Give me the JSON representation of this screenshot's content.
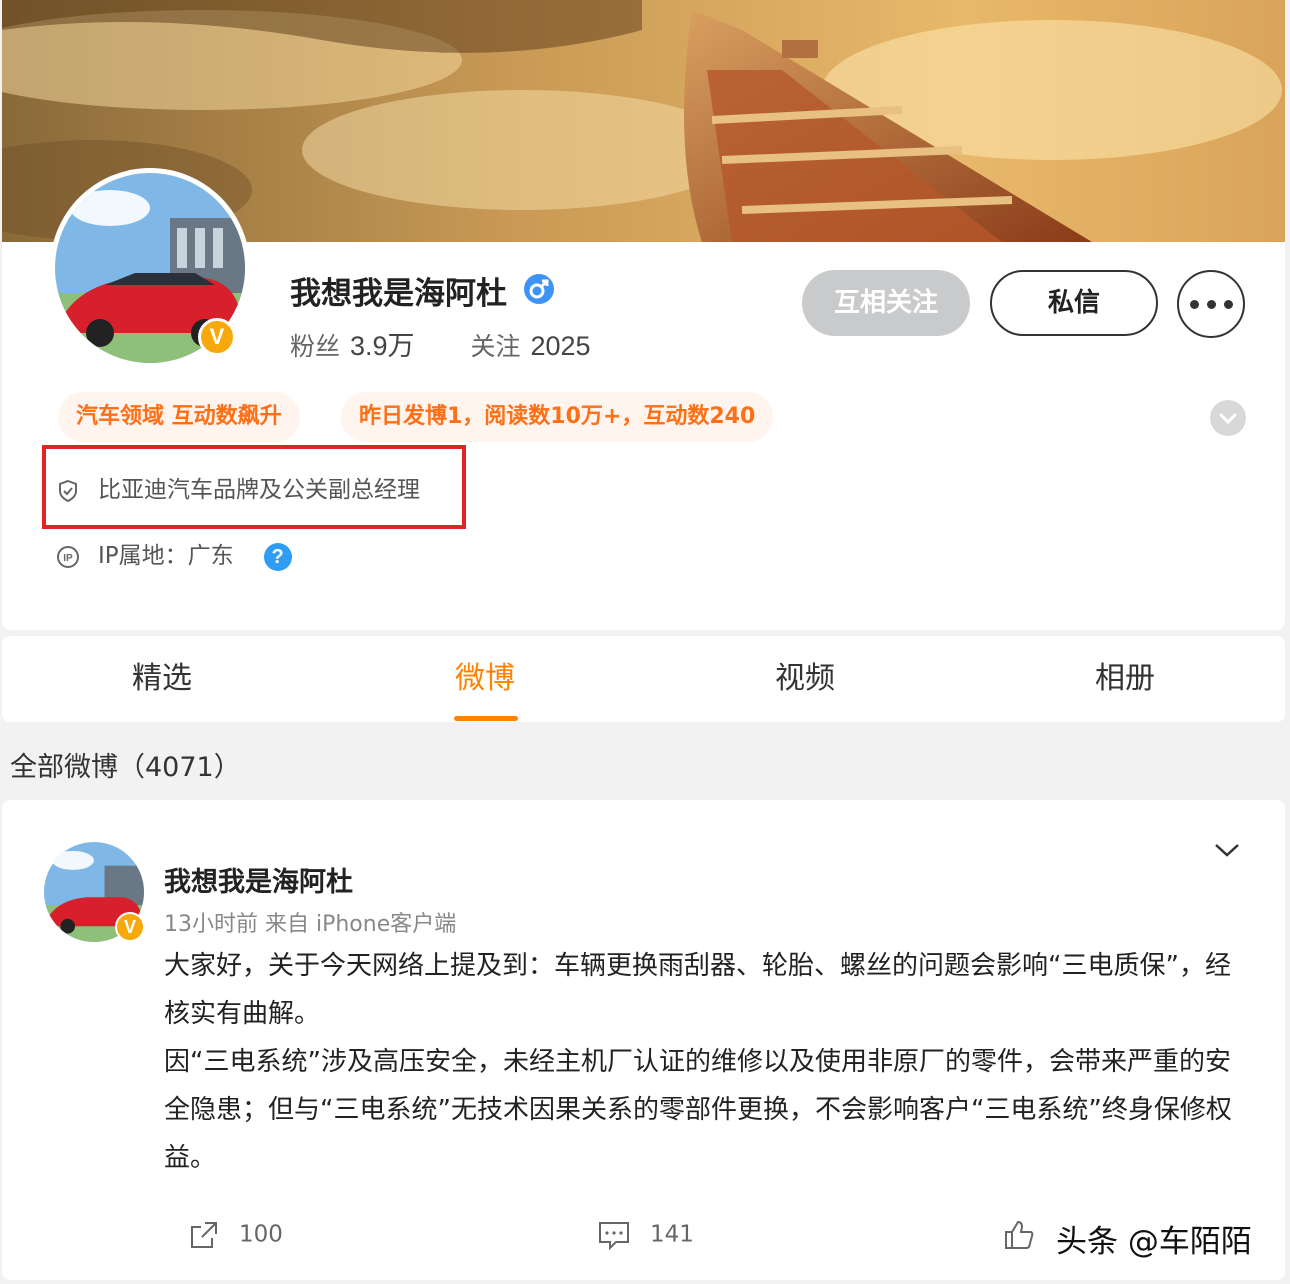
{
  "profile": {
    "username": "我想我是海阿杜",
    "verified_badge": "V",
    "followers_label": "粉丝",
    "followers_value": "3.9万",
    "following_label": "关注",
    "following_value": "2025",
    "mutual_button": "互相关注",
    "message_button": "私信",
    "tags": [
      "汽车领域 互动数飙升",
      "昨日发博1，阅读数10万+，互动数240"
    ],
    "verification": "比亚迪汽车品牌及公关副总经理",
    "ip_location": "IP属地：广东",
    "help_icon_text": "?",
    "icons": {
      "gender": "male-icon",
      "verify": "shield-check-icon",
      "ip": "ip-icon",
      "more": "more-dots-icon",
      "expand": "chevron-down-icon"
    }
  },
  "tabs": [
    {
      "label": "精选",
      "active": false
    },
    {
      "label": "微博",
      "active": true
    },
    {
      "label": "视频",
      "active": false
    },
    {
      "label": "相册",
      "active": false
    }
  ],
  "feed": {
    "all_count_label": "全部微博（4071）"
  },
  "post": {
    "author": "我想我是海阿杜",
    "meta": "13小时前  来自 iPhone客户端",
    "paragraphs": [
      "大家好，关于今天网络上提及到：车辆更换雨刮器、轮胎、螺丝的问题会影响“三电质保”，经核实有曲解。",
      "因“三电系统”涉及高压安全，未经主机厂认证的维修以及使用非原厂的零件，会带来严重的安全隐患；但与“三电系统”无技术因果关系的零部件更换，不会影响客户“三电系统”终身保修权益。"
    ],
    "share_count": "100",
    "comment_count": "141"
  },
  "watermark": "头条 @车陌陌",
  "colors": {
    "accent": "#ff8200",
    "tag_text": "#ff6f16",
    "tag_bg": "#fff4ee",
    "highlight": "#e52222",
    "verified": "#f7a90b"
  }
}
